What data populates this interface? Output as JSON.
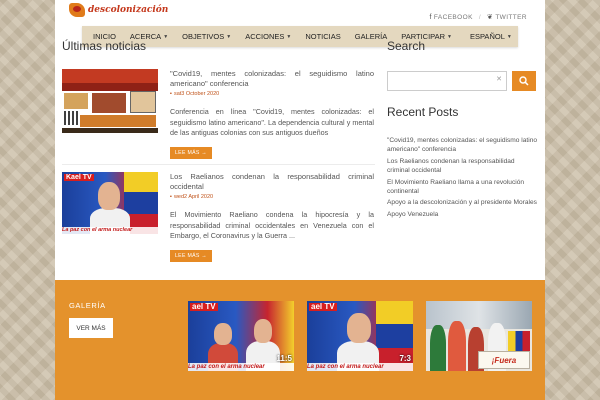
{
  "site": {
    "logo_text": "descolonización"
  },
  "social": {
    "facebook": "FACEBOOK",
    "separator": "/",
    "twitter": "TWITTER"
  },
  "nav": {
    "items": [
      "INICIO",
      "ACERCA",
      "OBJETIVOS",
      "ACCIONES",
      "NOTICIAS",
      "GALERÍA",
      "PARTICIPAR",
      "ESPAÑOL"
    ]
  },
  "main": {
    "section_title": "Últimas noticias",
    "posts": [
      {
        "title": "\"Covid19, mentes colonizadas: el seguidismo latino americano\" conferencia",
        "date": "sat3 October 2020",
        "excerpt": "Conferencia en línea \"Covid19, mentes colonizadas: el seguidismo latino americano\". La dependencia cultural y mental de las antiguas colonias con sus antiguos dueños",
        "read_more": "LEE MÁS →"
      },
      {
        "title": "Los Raelianos condenan la responsabilidad criminal occidental",
        "date": "wed2 April 2020",
        "excerpt": "El Movimiento Raeliano condena la hipocresía y la responsabilidad criminal occidentales en Venezuela con el Embargo, el Coronavirus y la Guerra ...",
        "read_more": "LEE MÁS →"
      }
    ]
  },
  "sidebar": {
    "search_title": "Search",
    "search_clear": "✕",
    "recent_title": "Recent Posts",
    "recent_posts": [
      "\"Covid19, mentes colonizadas: el seguidismo latino americano\" conferencia",
      "Los Raelianos condenan la responsabilidad criminal occidental",
      "El Movimiento Raeliano llama a una revolución continental",
      "Apoyo a la descolonización y al presidente Morales",
      "Apoyo Venezuela"
    ]
  },
  "gallery": {
    "title": "GALERÍA",
    "button": "VER MÁS",
    "thumbs": [
      {
        "badge": "ael TV",
        "caption": "La paz con el arma nuclear",
        "duration": "11:5"
      },
      {
        "badge": "ael TV",
        "caption": "La paz con el arma nuclear",
        "duration": "7:3"
      },
      {
        "sign": "¡Fuera Yankis!"
      }
    ]
  },
  "thumb_text": {
    "poster_head": "Covid19, mentes colonizadas: el seguidismo latino americano",
    "rael_badge": "Kael TV",
    "rael_caption": "La paz con el arma nuclear"
  },
  "colors": {
    "accent": "#e68a24",
    "nav_bg": "#e4d8bf",
    "gallery_bg": "#e4922c"
  }
}
